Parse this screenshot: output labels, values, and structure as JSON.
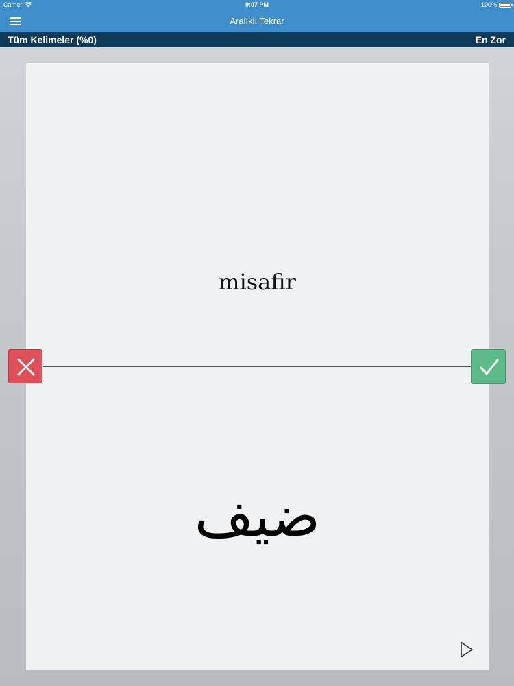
{
  "status_bar": {
    "carrier": "Carrier",
    "time": "9:07 PM",
    "battery": "100%",
    "battery_level": 1.0
  },
  "nav": {
    "title": "Aralıklı Tekrar",
    "menu_icon": "hamburger-menu-icon"
  },
  "sub_bar": {
    "filter_label": "Tüm Kelimeler (%0)",
    "sort_label": "En Zor"
  },
  "card": {
    "front_word": "misafir",
    "back_word": "ضيف",
    "play_icon": "play-icon"
  },
  "actions": {
    "wrong_icon": "close-icon",
    "right_icon": "checkmark-icon"
  },
  "colors": {
    "nav_bar": "#3f8dca",
    "sub_bar": "#0f3a59",
    "wrong_button": "#e0505a",
    "right_button": "#5dbb8a",
    "card_background": "#eff1f3"
  }
}
